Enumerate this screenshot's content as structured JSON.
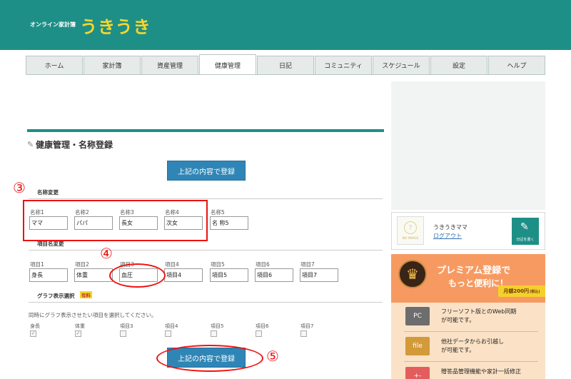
{
  "header": {
    "logo_small": "オンライン家計簿",
    "logo_big": "うきうき"
  },
  "tabs": [
    {
      "label": "ホーム"
    },
    {
      "label": "家計簿"
    },
    {
      "label": "資産管理"
    },
    {
      "label": "健康管理",
      "active": true
    },
    {
      "label": "日記"
    },
    {
      "label": "コミュニティ"
    },
    {
      "label": "スケジュール"
    },
    {
      "label": "設定"
    },
    {
      "label": "ヘルプ"
    }
  ],
  "page": {
    "title": "健康管理・名称登録",
    "submit_label": "上記の内容で登録"
  },
  "names_section": {
    "heading": "名称変更",
    "fields": [
      {
        "label": "名称1",
        "value": "ママ"
      },
      {
        "label": "名称2",
        "value": "パパ"
      },
      {
        "label": "名称3",
        "value": "長女"
      },
      {
        "label": "名称4",
        "value": "次女"
      },
      {
        "label": "名称5",
        "value": "名 称5"
      }
    ]
  },
  "items_section": {
    "heading": "項目名変更",
    "fields": [
      {
        "label": "項目1",
        "value": "身長"
      },
      {
        "label": "項目2",
        "value": "体重"
      },
      {
        "label": "項目3",
        "value": "血圧"
      },
      {
        "label": "項目4",
        "value": "項目4"
      },
      {
        "label": "項目5",
        "value": "項目5"
      },
      {
        "label": "項目6",
        "value": "項目6"
      },
      {
        "label": "項目7",
        "value": "項目7"
      }
    ]
  },
  "graph_section": {
    "heading": "グラフ表示選択",
    "badge": "有料",
    "hint": "同時にグラフ表示させたい項目を選択してください。",
    "checkboxes": [
      {
        "label": "身長",
        "checked": true
      },
      {
        "label": "体重",
        "checked": true
      },
      {
        "label": "項目3",
        "checked": false
      },
      {
        "label": "項目4",
        "checked": false
      },
      {
        "label": "項目5",
        "checked": false
      },
      {
        "label": "項目6",
        "checked": false
      },
      {
        "label": "項目7",
        "checked": false
      }
    ]
  },
  "annotations": {
    "step3": "③",
    "step4": "④",
    "step5": "⑤",
    "color": "#e11111"
  },
  "sidebar": {
    "avatar_text": "NO IMAGE",
    "user_name": "うきうきママ",
    "logout": "ログアウト",
    "diary_button": "日記を書く",
    "premium": {
      "title": "プレミアム登録で",
      "subtitle": "もっと便利に！",
      "price": "月額200円",
      "price_note": "(税込)",
      "features": [
        {
          "icon_label": "PC",
          "line1": "フリーソフト版とのWeb同期",
          "line2": "が可能です。"
        },
        {
          "icon_label": "file",
          "line1": "他社データからお引越し",
          "line2": "が可能です。"
        },
        {
          "icon_label": "+-",
          "line1": "贈答品管理機能や家計一括修正",
          "line2": ""
        }
      ]
    }
  },
  "colors": {
    "brand": "#1e8f87",
    "logo": "#f5d62e",
    "button": "#2f86b6",
    "premium": "#f79a62"
  }
}
